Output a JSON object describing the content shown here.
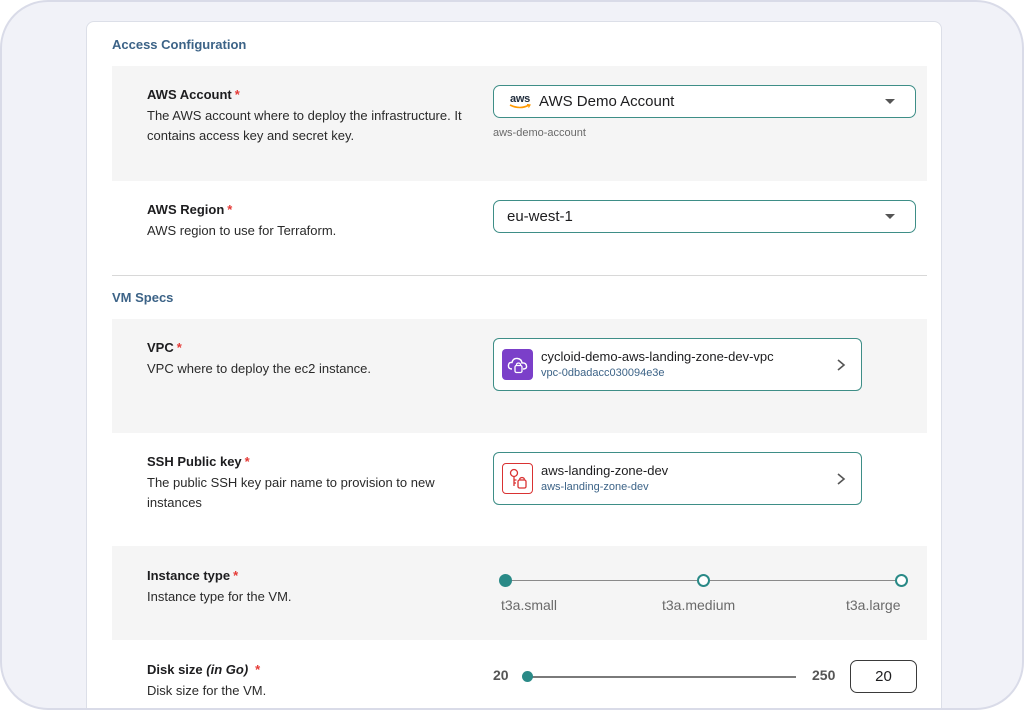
{
  "sections": {
    "access": "Access Configuration",
    "vm": "VM Specs"
  },
  "aws_account": {
    "label": "AWS Account",
    "required": "*",
    "description": "The AWS account where to deploy the infrastructure. It contains access key and secret key.",
    "selected": "AWS Demo Account",
    "logo_text": "aws",
    "hint": "aws-demo-account"
  },
  "aws_region": {
    "label": "AWS Region",
    "required": "*",
    "description": "AWS region to use for Terraform.",
    "selected": "eu-west-1"
  },
  "vpc": {
    "label": "VPC",
    "required": "*",
    "description": "VPC where to deploy the ec2 instance.",
    "name": "cycloid-demo-aws-landing-zone-dev-vpc",
    "id": "vpc-0dbadacc030094e3e",
    "icon": "vpc-cloud-lock-icon"
  },
  "ssh_key": {
    "label": "SSH Public key",
    "required": "*",
    "description": "The public SSH key pair name to provision to new instances",
    "name": "aws-landing-zone-dev",
    "id": "aws-landing-zone-dev",
    "icon": "key-lock-icon"
  },
  "instance_type": {
    "label": "Instance type",
    "required": "*",
    "description": "Instance type for the VM.",
    "options": [
      "t3a.small",
      "t3a.medium",
      "t3a.large"
    ],
    "selected_index": 0
  },
  "disk_size": {
    "label": "Disk size",
    "label_note": "(in Go)",
    "required": "*",
    "description": "Disk size for the VM.",
    "min": "20",
    "max": "250",
    "value": "20"
  },
  "colors": {
    "accent": "#2a8a87",
    "section_title": "#3c6387",
    "required": "#e53935"
  }
}
